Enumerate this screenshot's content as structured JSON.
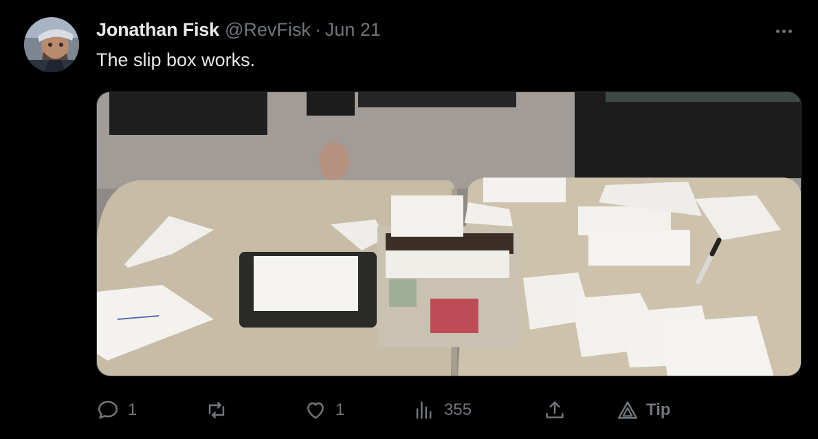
{
  "tweet": {
    "author_name": "Jonathan Fisk",
    "handle": "@RevFisk",
    "separator": "·",
    "date": "Jun 21",
    "text": "The slip box works."
  },
  "media": {
    "icon": "photo",
    "colors": {
      "cushion": "#c9bfa9",
      "floor": "#9a9590",
      "wicker": "#222222",
      "card": "#f2f1ee"
    }
  },
  "actions": {
    "reply_count": "1",
    "repost_count": "",
    "like_count": "1",
    "views_count": "355",
    "tip_label": "Tip"
  },
  "icons": [
    "more-icon",
    "reply-icon",
    "repost-icon",
    "like-icon",
    "views-icon",
    "share-icon",
    "tip-icon"
  ],
  "colors": {
    "background": "#000000",
    "text": "#e7e9ea",
    "muted": "#71767b",
    "border": "#2f3336"
  }
}
